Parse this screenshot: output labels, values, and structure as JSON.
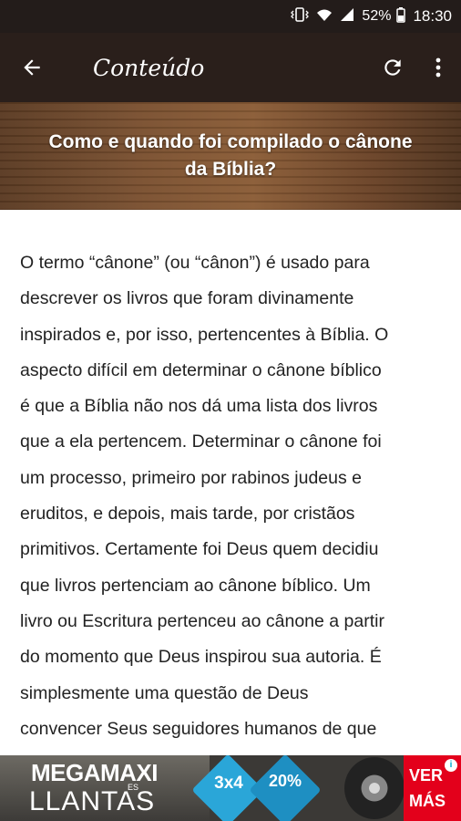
{
  "status_bar": {
    "battery": "52%",
    "time": "18:30"
  },
  "app_bar": {
    "title": "Conteúdo",
    "icons": [
      "back-arrow-icon",
      "refresh-icon",
      "more-vert-icon"
    ]
  },
  "article": {
    "heading": "Como e quando foi compilado o cânone da Bíblia?",
    "lines": [
      "O termo “cânone” (ou “cânon”) é usado para",
      "descrever os livros que foram divinamente",
      "inspirados e, por isso, pertencentes à Bíblia. O",
      "aspecto difícil em determinar o cânone bíblico",
      "é que a Bíblia não nos dá uma lista dos livros",
      "que a ela pertencem. Determinar o cânone foi",
      "um processo, primeiro por rabinos judeus e",
      "eruditos, e depois, mais tarde, por cristãos",
      "primitivos. Certamente foi Deus quem decidiu",
      "que livros pertenciam ao cânone bíblico. Um",
      "livro ou Escritura pertenceu ao cânone a partir",
      "do momento que Deus inspirou sua autoria. É",
      "simplesmente uma questão de Deus",
      "convencer Seus seguidores humanos de que"
    ]
  },
  "ad": {
    "brand_line1": "MEGAMAXI",
    "brand_small": "ES",
    "brand_line2": "LLANTAS",
    "badge1": "3x4",
    "badge2": "20%",
    "cta_line1": "VER",
    "cta_line2": "MÁS",
    "info": "i"
  },
  "colors": {
    "status_bg": "#231c1a",
    "appbar_bg": "#2a1f1b",
    "text": "#222222",
    "ad_red": "#e3001b"
  }
}
